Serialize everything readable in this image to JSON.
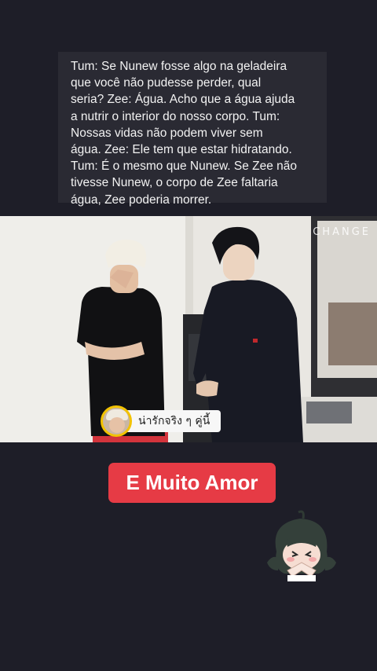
{
  "caption": {
    "text": "Tum: Se Nunew fosse algo na geladeira\nque você não pudesse perder, qual\nseria? Zee: Água. Acho que a água ajuda\na nutrir o interior do nosso corpo. Tum:\nNossas vidas não podem viver sem\nágua. Zee: Ele tem que estar hidratando.\nTum: É o mesmo que Nunew. Se Zee não\ntivesse Nunew, o corpo de Zee faltaria\nágua, Zee poderia morrer."
  },
  "video": {
    "watermark": "CHANGE",
    "subtitle": "น่ารักจริง ๆ คู่นี้"
  },
  "highlight": {
    "label": "E Muito Amor"
  },
  "colors": {
    "background": "#1e1e28",
    "caption_bg": "#2a2a33",
    "accent_red": "#e63b45",
    "avatar_ring": "#f2c200"
  },
  "icons": {
    "sticker": "anime-girl-sticker-icon",
    "subtitle_avatar": "avatar-icon"
  }
}
